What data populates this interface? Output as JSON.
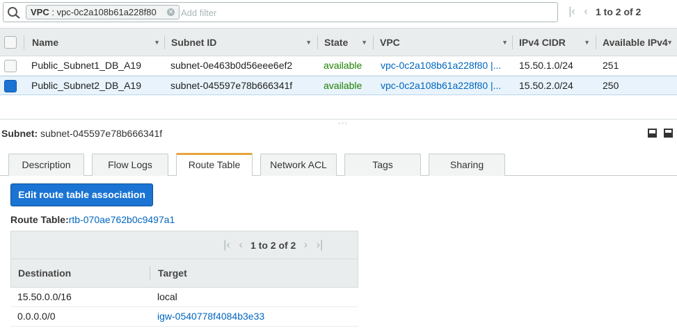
{
  "filter": {
    "token_key": "VPC",
    "token_value": "vpc-0c2a108b61a228f80",
    "placeholder": "Add filter"
  },
  "grid": {
    "pagination": "1 to 2 of 2",
    "columns": [
      "Name",
      "Subnet ID",
      "State",
      "VPC",
      "IPv4 CIDR",
      "Available IPv4"
    ],
    "rows": [
      {
        "name": "Public_Subnet1_DB_A19",
        "subnet_id": "subnet-0e463b0d56eee6ef2",
        "state": "available",
        "vpc": "vpc-0c2a108b61a228f80 |...",
        "cidr": "15.50.1.0/24",
        "available": "251",
        "selected": false
      },
      {
        "name": "Public_Subnet2_DB_A19",
        "subnet_id": "subnet-045597e78b666341f",
        "state": "available",
        "vpc": "vpc-0c2a108b61a228f80 |...",
        "cidr": "15.50.2.0/24",
        "available": "250",
        "selected": true
      }
    ]
  },
  "details": {
    "label": "Subnet:",
    "subnet_id": "subnet-045597e78b666341f",
    "tabs": [
      "Description",
      "Flow Logs",
      "Route Table",
      "Network ACL",
      "Tags",
      "Sharing"
    ],
    "active_tab": "Route Table",
    "edit_button": "Edit route table association",
    "route_table_label": "Route Table:",
    "route_table_id": "rtb-070ae762b0c9497a1",
    "routes_pagination": "1 to 2 of 2",
    "route_columns": [
      "Destination",
      "Target"
    ],
    "routes": [
      {
        "destination": "15.50.0.0/16",
        "target": "local",
        "target_is_link": false
      },
      {
        "destination": "0.0.0.0/0",
        "target": "igw-0540778f4084b3e33",
        "target_is_link": true
      }
    ]
  },
  "colors": {
    "accent": "#1b74d3",
    "link": "#0066c0",
    "available": "#1d8102",
    "active_tab": "#e8a43c"
  },
  "icons": [
    "search-icon",
    "close-icon",
    "first-page-icon",
    "prev-page-icon",
    "next-page-icon",
    "last-page-icon",
    "sort-caret-icon",
    "collapse-pane-icon",
    "maximize-pane-icon"
  ]
}
